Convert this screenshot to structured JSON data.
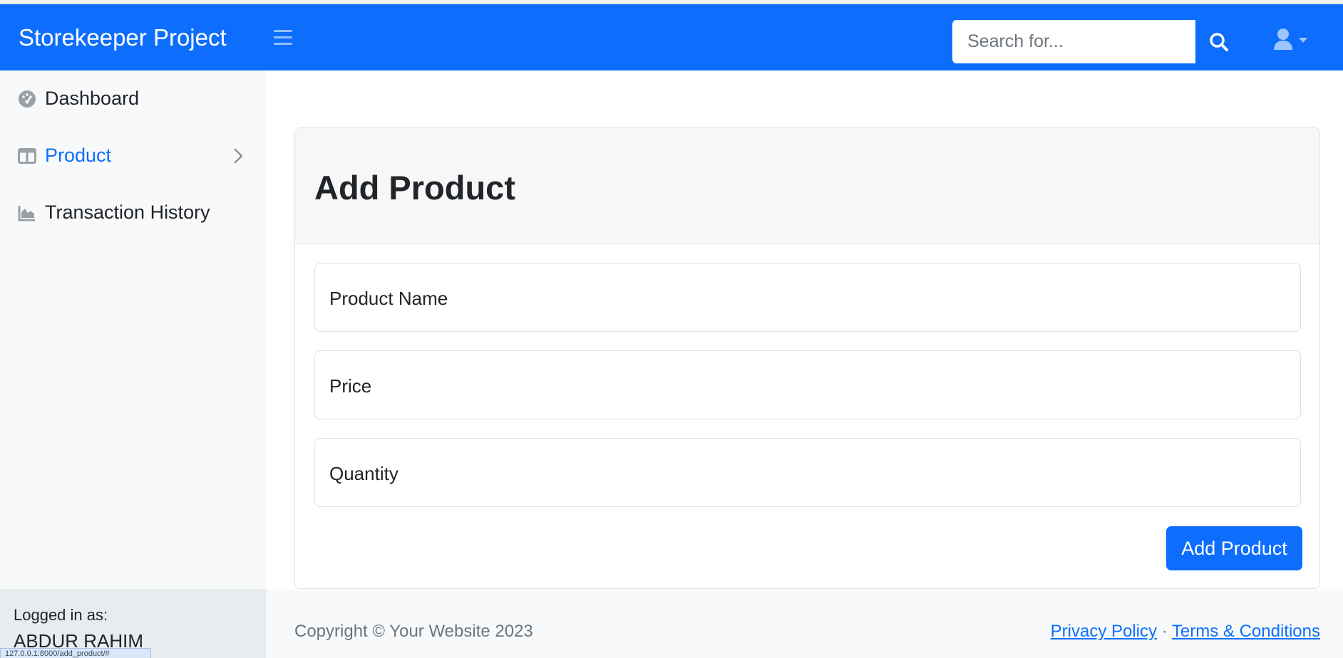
{
  "navbar": {
    "brand": "Storekeeper Project",
    "search_placeholder": "Search for...",
    "accent": "#0d6efd"
  },
  "sidebar": {
    "items": [
      {
        "label": "Dashboard",
        "icon": "tachometer-icon",
        "active": false
      },
      {
        "label": "Product",
        "icon": "columns-icon",
        "active": true,
        "has_submenu": true
      },
      {
        "label": "Transaction History",
        "icon": "area-chart-icon",
        "active": false
      }
    ],
    "footer": {
      "logged_in_label": "Logged in as:",
      "username": "ABDUR RAHIM"
    }
  },
  "status_bar": {
    "url": "127.0.0.1:8000/add_product/#"
  },
  "card": {
    "title": "Add Product",
    "fields": [
      {
        "label": "Product Name"
      },
      {
        "label": "Price"
      },
      {
        "label": "Quantity"
      }
    ],
    "submit_label": "Add Product"
  },
  "footer": {
    "copyright": "Copyright © Your Website 2023",
    "privacy_link": "Privacy Policy",
    "separator": "·",
    "terms_link": "Terms & Conditions"
  }
}
